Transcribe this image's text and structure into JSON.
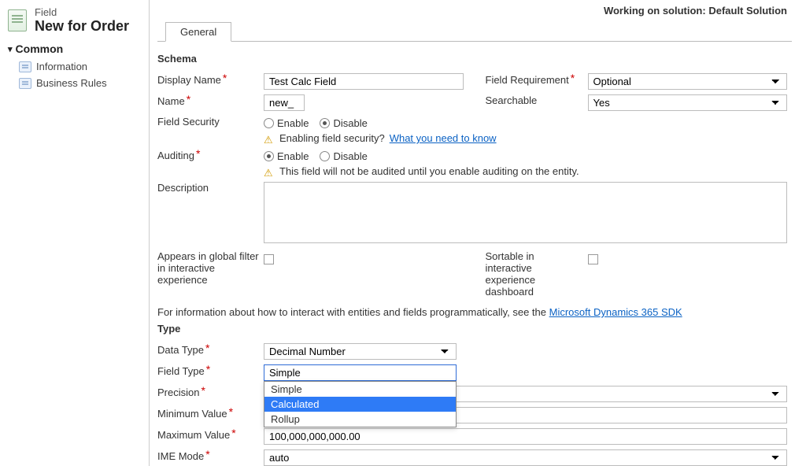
{
  "header": {
    "eyebrow": "Field",
    "title": "New for Order",
    "solution_label": "Working on solution:",
    "solution_name": "Default Solution"
  },
  "sidebar": {
    "section": "Common",
    "items": [
      {
        "label": "Information"
      },
      {
        "label": "Business Rules"
      }
    ]
  },
  "tabs": {
    "general": "General"
  },
  "schema": {
    "title": "Schema",
    "display_name_label": "Display Name",
    "display_name_value": "Test Calc Field",
    "field_req_label": "Field Requirement",
    "field_req_value": "Optional",
    "name_label": "Name",
    "name_value": "new_",
    "searchable_label": "Searchable",
    "searchable_value": "Yes",
    "field_security_label": "Field Security",
    "enable": "Enable",
    "disable": "Disable",
    "fs_warn": "Enabling field security?",
    "fs_link": "What you need to know",
    "auditing_label": "Auditing",
    "audit_warn": "This field will not be audited until you enable auditing on the entity.",
    "description_label": "Description",
    "description_value": "",
    "global_filter_label": "Appears in global filter in interactive experience",
    "sortable_label": "Sortable in interactive experience dashboard",
    "sdk_text": "For information about how to interact with entities and fields programmatically, see the",
    "sdk_link": "Microsoft Dynamics 365 SDK"
  },
  "type": {
    "title": "Type",
    "data_type_label": "Data Type",
    "data_type_value": "Decimal Number",
    "field_type_label": "Field Type",
    "field_type_value": "Simple",
    "field_type_options": [
      "Simple",
      "Calculated",
      "Rollup"
    ],
    "field_type_selected": "Calculated",
    "precision_label": "Precision",
    "precision_value": "",
    "min_label": "Minimum Value",
    "min_value": "",
    "max_label": "Maximum Value",
    "max_value": "100,000,000,000.00",
    "ime_label": "IME Mode",
    "ime_value": "auto"
  }
}
